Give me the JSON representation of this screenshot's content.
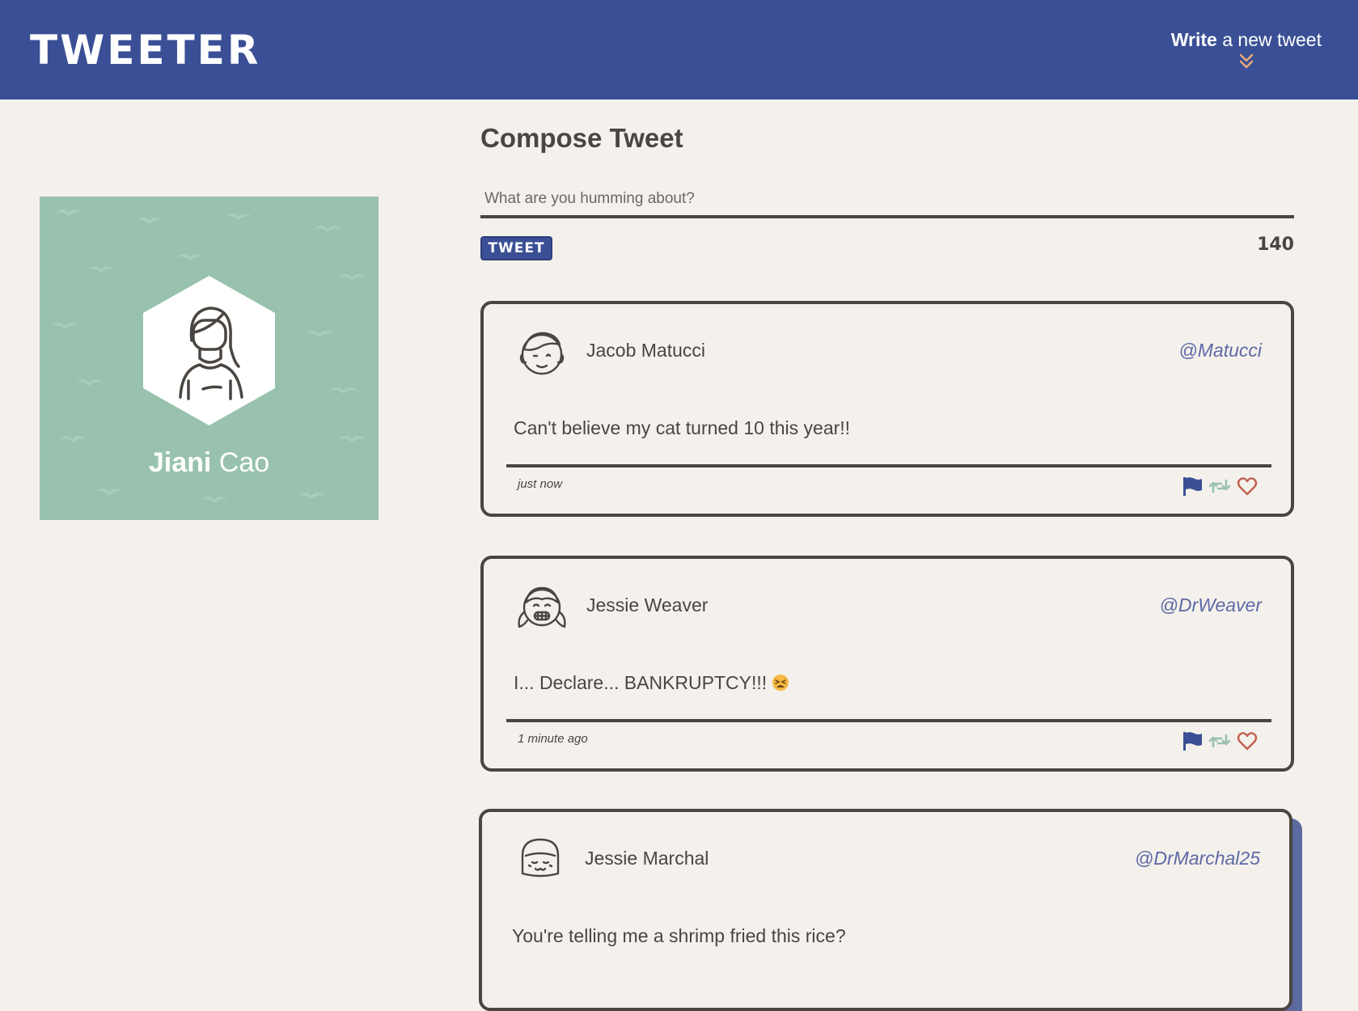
{
  "header": {
    "logo": "TWEETER",
    "write_bold": "Write",
    "write_rest": " a new tweet"
  },
  "profile": {
    "first_name": "Jiani",
    "last_name": "Cao"
  },
  "compose": {
    "title": "Compose Tweet",
    "placeholder": "What are you humming about?",
    "button_label": "TWEET",
    "counter": "140"
  },
  "tweets": [
    {
      "author": "Jacob Matucci",
      "handle": "@Matucci",
      "content": "Can't believe my cat turned 10 this year!!",
      "timestamp": "just now",
      "avatar": "boy-avatar-icon"
    },
    {
      "author": "Jessie Weaver",
      "handle": "@DrWeaver",
      "content": "I... Declare... BANKRUPTCY!!!",
      "emoji": "tired-face-emoji",
      "timestamp": "1 minute ago",
      "avatar": "girl-pigtails-avatar-icon"
    },
    {
      "author": "Jessie Marchal",
      "handle": "@DrMarchal25",
      "content": "You're telling me a shrimp fried this rice?",
      "avatar": "girl-bangs-avatar-icon"
    }
  ],
  "colors": {
    "header_bg": "#3a4f95",
    "page_bg": "#f4f1ec",
    "profile_bg": "#98c2ad",
    "text": "#4a4540",
    "handle": "#5e69a6",
    "chevron": "#e8a87c",
    "flag": "#3a4f95",
    "retweet": "#98c2ad",
    "heart": "#c0624f"
  }
}
